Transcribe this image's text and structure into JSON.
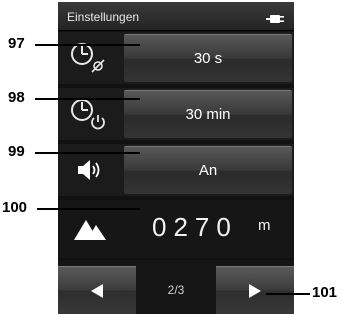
{
  "header": {
    "title": "Einstellungen",
    "battery_icon": "battery-plug-icon"
  },
  "settings": {
    "timeout": {
      "value": "30 s",
      "icon": "display-timeout-icon"
    },
    "auto_off": {
      "value": "30 min",
      "icon": "power-off-timer-icon"
    },
    "sound": {
      "value": "An",
      "icon": "speaker-icon"
    },
    "altitude": {
      "value": "0270",
      "unit": "m",
      "icon": "mountain-icon"
    }
  },
  "footer": {
    "page": "2/3",
    "prev_icon": "triangle-left-icon",
    "next_icon": "triangle-right-icon"
  },
  "callouts": [
    "97",
    "98",
    "99",
    "100",
    "101"
  ],
  "colors": {
    "background": "#111111",
    "text": "#ffffff"
  }
}
